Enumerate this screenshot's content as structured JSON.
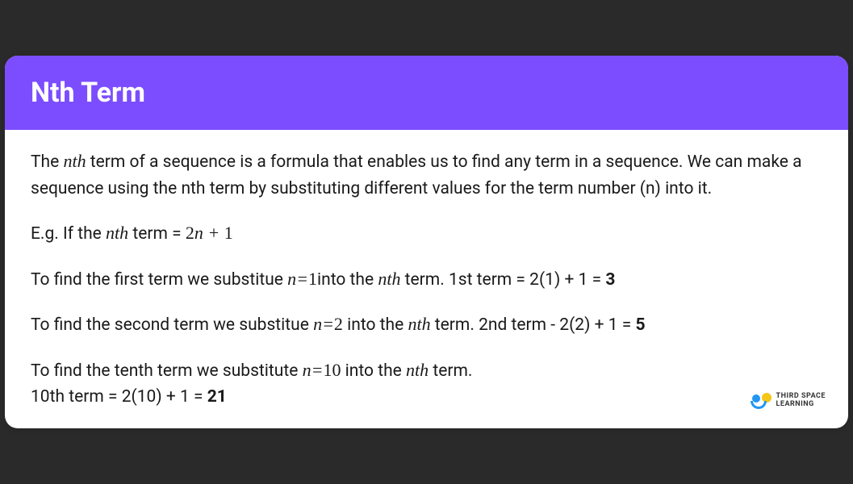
{
  "header": {
    "title": "Nth Term"
  },
  "content": {
    "intro_part1": "The ",
    "intro_math1": "nth",
    "intro_part2": " term of a sequence is a formula that enables us to find any term in a sequence. We can make a sequence using the nth term by substituting different values for the term number (n) into it.",
    "example_label": "E.g. If the ",
    "example_math1": "nth",
    "example_mid": " term = ",
    "example_formula": "2n + 1",
    "first_part1": "To find the first term we substitue  ",
    "first_sub": "n=1",
    "first_part2": "into the ",
    "first_math": "nth",
    "first_part3": " term. 1st term = 2(1) + 1 = ",
    "first_result": "3",
    "second_part1": "To find the second term we substitue ",
    "second_sub": "n=2",
    "second_part2": " into the ",
    "second_math": "nth",
    "second_part3": " term. 2nd term - 2(2) + 1 = ",
    "second_result": "5",
    "tenth_part1": "To find the tenth term we substitute ",
    "tenth_sub": "n=10",
    "tenth_part2": " into the ",
    "tenth_math": "nth",
    "tenth_part3": " term.",
    "tenth_line2a": "10th term = 2(10) + 1 = ",
    "tenth_result": "21"
  },
  "logo": {
    "line1": "THIRD SPACE",
    "line2": "LEARNING"
  }
}
